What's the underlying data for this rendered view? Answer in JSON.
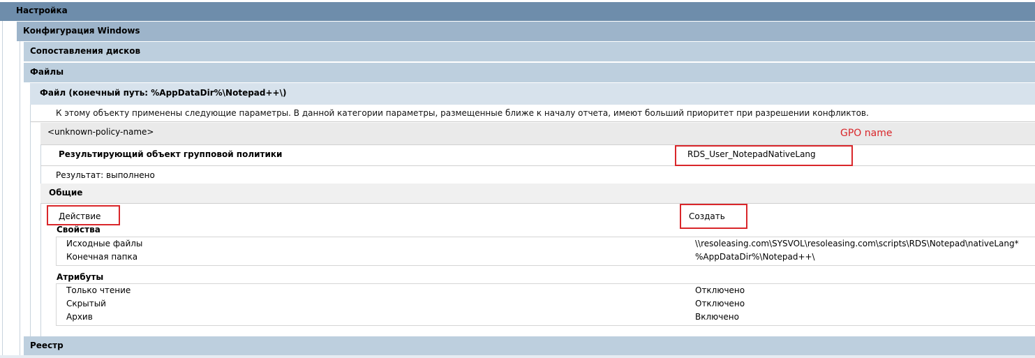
{
  "sections": {
    "root": "Настройка",
    "windows_config": "Конфигурация Windows",
    "drive_maps": "Сопоставления дисков",
    "files": "Файлы",
    "file_item": "Файл (конечный путь: %AppDataDir%\\Notepad++\\)",
    "registry": "Реестр"
  },
  "notice": "К этому объекту применены следующие параметры. В данной категории параметры, размещенные ближе к началу отчета, имеют больший приоритет при разрешении конфликтов.",
  "policy": {
    "name": "<unknown-policy-name>",
    "gpo_label": "Результирующий объект групповой политики",
    "gpo_value": "RDS_User_NotepadNativeLang",
    "result": "Результат: выполнено"
  },
  "general": {
    "title": "Общие",
    "action_label": "Действие",
    "action_value": "Создать"
  },
  "properties": {
    "title": "Свойства",
    "rows": [
      {
        "name": "Исходные файлы",
        "value": "\\\\resoleasing.com\\SYSVOL\\resoleasing.com\\scripts\\RDS\\Notepad\\nativeLang*"
      },
      {
        "name": "Конечная папка",
        "value": "%AppDataDir%\\Notepad++\\"
      }
    ]
  },
  "attributes": {
    "title": "Атрибуты",
    "rows": [
      {
        "name": "Только чтение",
        "value": "Отключено"
      },
      {
        "name": "Скрытый",
        "value": "Отключено"
      },
      {
        "name": "Архив",
        "value": "Включено"
      }
    ]
  },
  "annotation": {
    "gpo_name_label": "GPO name",
    "accent_color": "#d9262a"
  }
}
